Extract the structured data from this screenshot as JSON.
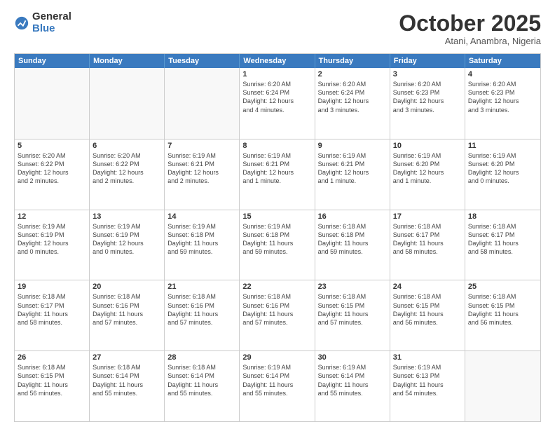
{
  "logo": {
    "general": "General",
    "blue": "Blue"
  },
  "header": {
    "month": "October 2025",
    "location": "Atani, Anambra, Nigeria"
  },
  "weekdays": [
    "Sunday",
    "Monday",
    "Tuesday",
    "Wednesday",
    "Thursday",
    "Friday",
    "Saturday"
  ],
  "rows": [
    [
      {
        "day": "",
        "info": ""
      },
      {
        "day": "",
        "info": ""
      },
      {
        "day": "",
        "info": ""
      },
      {
        "day": "1",
        "info": "Sunrise: 6:20 AM\nSunset: 6:24 PM\nDaylight: 12 hours\nand 4 minutes."
      },
      {
        "day": "2",
        "info": "Sunrise: 6:20 AM\nSunset: 6:24 PM\nDaylight: 12 hours\nand 3 minutes."
      },
      {
        "day": "3",
        "info": "Sunrise: 6:20 AM\nSunset: 6:23 PM\nDaylight: 12 hours\nand 3 minutes."
      },
      {
        "day": "4",
        "info": "Sunrise: 6:20 AM\nSunset: 6:23 PM\nDaylight: 12 hours\nand 3 minutes."
      }
    ],
    [
      {
        "day": "5",
        "info": "Sunrise: 6:20 AM\nSunset: 6:22 PM\nDaylight: 12 hours\nand 2 minutes."
      },
      {
        "day": "6",
        "info": "Sunrise: 6:20 AM\nSunset: 6:22 PM\nDaylight: 12 hours\nand 2 minutes."
      },
      {
        "day": "7",
        "info": "Sunrise: 6:19 AM\nSunset: 6:21 PM\nDaylight: 12 hours\nand 2 minutes."
      },
      {
        "day": "8",
        "info": "Sunrise: 6:19 AM\nSunset: 6:21 PM\nDaylight: 12 hours\nand 1 minute."
      },
      {
        "day": "9",
        "info": "Sunrise: 6:19 AM\nSunset: 6:21 PM\nDaylight: 12 hours\nand 1 minute."
      },
      {
        "day": "10",
        "info": "Sunrise: 6:19 AM\nSunset: 6:20 PM\nDaylight: 12 hours\nand 1 minute."
      },
      {
        "day": "11",
        "info": "Sunrise: 6:19 AM\nSunset: 6:20 PM\nDaylight: 12 hours\nand 0 minutes."
      }
    ],
    [
      {
        "day": "12",
        "info": "Sunrise: 6:19 AM\nSunset: 6:19 PM\nDaylight: 12 hours\nand 0 minutes."
      },
      {
        "day": "13",
        "info": "Sunrise: 6:19 AM\nSunset: 6:19 PM\nDaylight: 12 hours\nand 0 minutes."
      },
      {
        "day": "14",
        "info": "Sunrise: 6:19 AM\nSunset: 6:18 PM\nDaylight: 11 hours\nand 59 minutes."
      },
      {
        "day": "15",
        "info": "Sunrise: 6:19 AM\nSunset: 6:18 PM\nDaylight: 11 hours\nand 59 minutes."
      },
      {
        "day": "16",
        "info": "Sunrise: 6:18 AM\nSunset: 6:18 PM\nDaylight: 11 hours\nand 59 minutes."
      },
      {
        "day": "17",
        "info": "Sunrise: 6:18 AM\nSunset: 6:17 PM\nDaylight: 11 hours\nand 58 minutes."
      },
      {
        "day": "18",
        "info": "Sunrise: 6:18 AM\nSunset: 6:17 PM\nDaylight: 11 hours\nand 58 minutes."
      }
    ],
    [
      {
        "day": "19",
        "info": "Sunrise: 6:18 AM\nSunset: 6:17 PM\nDaylight: 11 hours\nand 58 minutes."
      },
      {
        "day": "20",
        "info": "Sunrise: 6:18 AM\nSunset: 6:16 PM\nDaylight: 11 hours\nand 57 minutes."
      },
      {
        "day": "21",
        "info": "Sunrise: 6:18 AM\nSunset: 6:16 PM\nDaylight: 11 hours\nand 57 minutes."
      },
      {
        "day": "22",
        "info": "Sunrise: 6:18 AM\nSunset: 6:16 PM\nDaylight: 11 hours\nand 57 minutes."
      },
      {
        "day": "23",
        "info": "Sunrise: 6:18 AM\nSunset: 6:15 PM\nDaylight: 11 hours\nand 57 minutes."
      },
      {
        "day": "24",
        "info": "Sunrise: 6:18 AM\nSunset: 6:15 PM\nDaylight: 11 hours\nand 56 minutes."
      },
      {
        "day": "25",
        "info": "Sunrise: 6:18 AM\nSunset: 6:15 PM\nDaylight: 11 hours\nand 56 minutes."
      }
    ],
    [
      {
        "day": "26",
        "info": "Sunrise: 6:18 AM\nSunset: 6:15 PM\nDaylight: 11 hours\nand 56 minutes."
      },
      {
        "day": "27",
        "info": "Sunrise: 6:18 AM\nSunset: 6:14 PM\nDaylight: 11 hours\nand 55 minutes."
      },
      {
        "day": "28",
        "info": "Sunrise: 6:18 AM\nSunset: 6:14 PM\nDaylight: 11 hours\nand 55 minutes."
      },
      {
        "day": "29",
        "info": "Sunrise: 6:19 AM\nSunset: 6:14 PM\nDaylight: 11 hours\nand 55 minutes."
      },
      {
        "day": "30",
        "info": "Sunrise: 6:19 AM\nSunset: 6:14 PM\nDaylight: 11 hours\nand 55 minutes."
      },
      {
        "day": "31",
        "info": "Sunrise: 6:19 AM\nSunset: 6:13 PM\nDaylight: 11 hours\nand 54 minutes."
      },
      {
        "day": "",
        "info": ""
      }
    ]
  ]
}
